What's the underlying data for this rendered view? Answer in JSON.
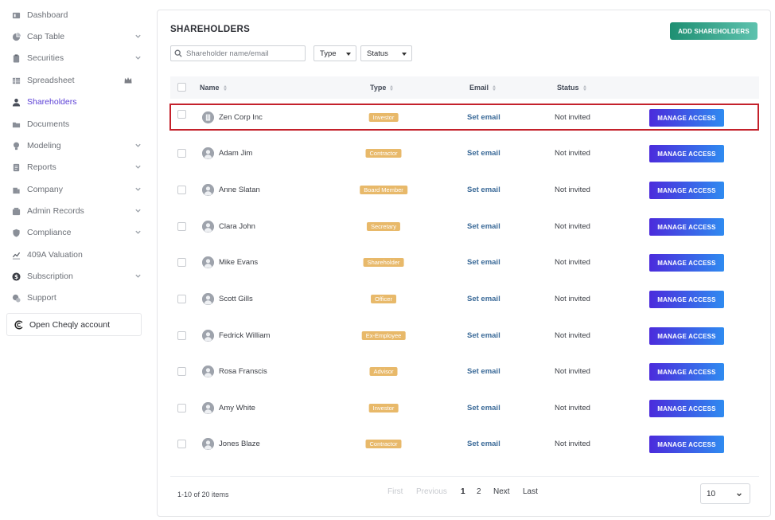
{
  "sidebar": {
    "items": [
      {
        "label": "Dashboard",
        "icon": "dashboard-icon",
        "chevron": false
      },
      {
        "label": "Cap Table",
        "icon": "pie-chart-icon",
        "chevron": true
      },
      {
        "label": "Securities",
        "icon": "clipboard-icon",
        "chevron": true
      },
      {
        "label": "Spreadsheet",
        "icon": "spreadsheet-icon",
        "chevron": false,
        "crown": true
      },
      {
        "label": "Shareholders",
        "icon": "user-icon",
        "chevron": false,
        "active": true
      },
      {
        "label": "Documents",
        "icon": "folder-icon",
        "chevron": false
      },
      {
        "label": "Modeling",
        "icon": "lightbulb-icon",
        "chevron": true
      },
      {
        "label": "Reports",
        "icon": "report-icon",
        "chevron": true
      },
      {
        "label": "Company",
        "icon": "building-icon",
        "chevron": true
      },
      {
        "label": "Admin Records",
        "icon": "records-icon",
        "chevron": true
      },
      {
        "label": "Compliance",
        "icon": "shield-icon",
        "chevron": true
      },
      {
        "label": "409A Valuation",
        "icon": "chart-icon",
        "chevron": false
      },
      {
        "label": "Subscription",
        "icon": "dollar-icon",
        "chevron": true
      },
      {
        "label": "Support",
        "icon": "support-icon",
        "chevron": false
      }
    ],
    "open_account": "Open Cheqly account"
  },
  "header": {
    "title": "SHAREHOLDERS",
    "add_button": "ADD SHAREHOLDERS"
  },
  "filters": {
    "search_placeholder": "Shareholder name/email",
    "search_value": "",
    "type_label": "Type",
    "status_label": "Status"
  },
  "table": {
    "columns": {
      "name": "Name",
      "type": "Type",
      "email": "Email",
      "status": "Status"
    },
    "rows": [
      {
        "name": "Zen Corp Inc",
        "type": "Investor",
        "email": "Set email",
        "status": "Not invited",
        "action": "MANAGE ACCESS",
        "avatar": "building-avatar-icon",
        "highlight": true
      },
      {
        "name": "Adam Jim",
        "type": "Contractor",
        "email": "Set email",
        "status": "Not invited",
        "action": "MANAGE ACCESS",
        "avatar": "person-avatar-icon"
      },
      {
        "name": "Anne Slatan",
        "type": "Board Member",
        "email": "Set email",
        "status": "Not invited",
        "action": "MANAGE ACCESS",
        "avatar": "person-avatar-icon"
      },
      {
        "name": "Clara John",
        "type": "Secretary",
        "email": "Set email",
        "status": "Not invited",
        "action": "MANAGE ACCESS",
        "avatar": "person-avatar-icon"
      },
      {
        "name": "Mike Evans",
        "type": "Shareholder",
        "email": "Set email",
        "status": "Not invited",
        "action": "MANAGE ACCESS",
        "avatar": "person-avatar-icon"
      },
      {
        "name": "Scott Gills",
        "type": "Officer",
        "email": "Set email",
        "status": "Not invited",
        "action": "MANAGE ACCESS",
        "avatar": "person-avatar-icon"
      },
      {
        "name": "Fedrick William",
        "type": "Ex-Employee",
        "email": "Set email",
        "status": "Not invited",
        "action": "MANAGE ACCESS",
        "avatar": "person-avatar-icon"
      },
      {
        "name": "Rosa Franscis",
        "type": "Advisor",
        "email": "Set email",
        "status": "Not invited",
        "action": "MANAGE ACCESS",
        "avatar": "person-avatar-icon"
      },
      {
        "name": "Amy White",
        "type": "Investor",
        "email": "Set email",
        "status": "Not invited",
        "action": "MANAGE ACCESS",
        "avatar": "person-avatar-icon"
      },
      {
        "name": "Jones Blaze",
        "type": "Contractor",
        "email": "Set email",
        "status": "Not invited",
        "action": "MANAGE ACCESS",
        "avatar": "person-avatar-icon"
      }
    ]
  },
  "pagination": {
    "info": "1-10 of 20 items",
    "first": "First",
    "previous": "Previous",
    "pages": [
      "1",
      "2"
    ],
    "current_page": "1",
    "next": "Next",
    "last": "Last",
    "page_size": "10"
  },
  "colors": {
    "accent": "#5b3fd6",
    "add_button": "#1e8f72",
    "manage_button": "#4b2bdc",
    "badge": "#e8b96a",
    "email_link": "#3b6a98",
    "highlight_border": "#c4212b"
  }
}
